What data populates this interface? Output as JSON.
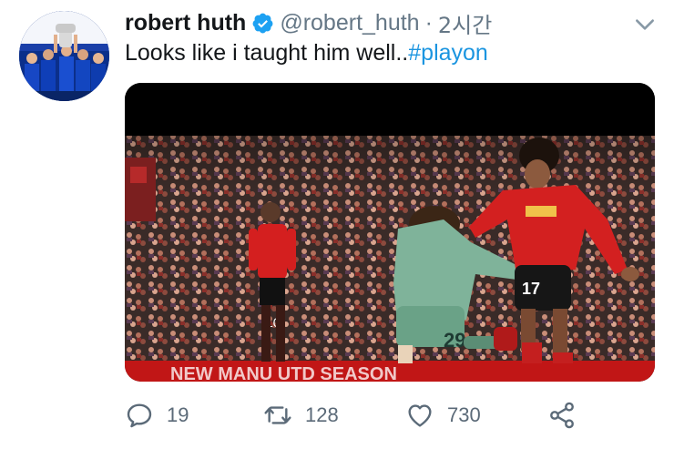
{
  "tweet": {
    "author_name": "robert huth",
    "handle": "@robert_huth",
    "separator": "·",
    "time": "2시간",
    "text_main": "Looks like i taught him well..",
    "hashtag": "#playon"
  },
  "media": {
    "board_text": "NEW MANU UTD SEASON",
    "shirt_number_green": "29",
    "shirt_number_red_right": "17",
    "shirt_number_red_left": "10"
  },
  "actions": {
    "reply_count": "19",
    "retweet_count": "128",
    "like_count": "730"
  },
  "colors": {
    "link": "#1b95e0",
    "verified": "#1da1f2",
    "icon": "#5b6a78",
    "text": "#14171a",
    "muted": "#657786"
  },
  "icons": {
    "verified": "verified-badge-icon",
    "caret": "chevron-down-icon",
    "reply": "reply-icon",
    "retweet": "retweet-icon",
    "like": "heart-icon",
    "share": "share-icon"
  }
}
